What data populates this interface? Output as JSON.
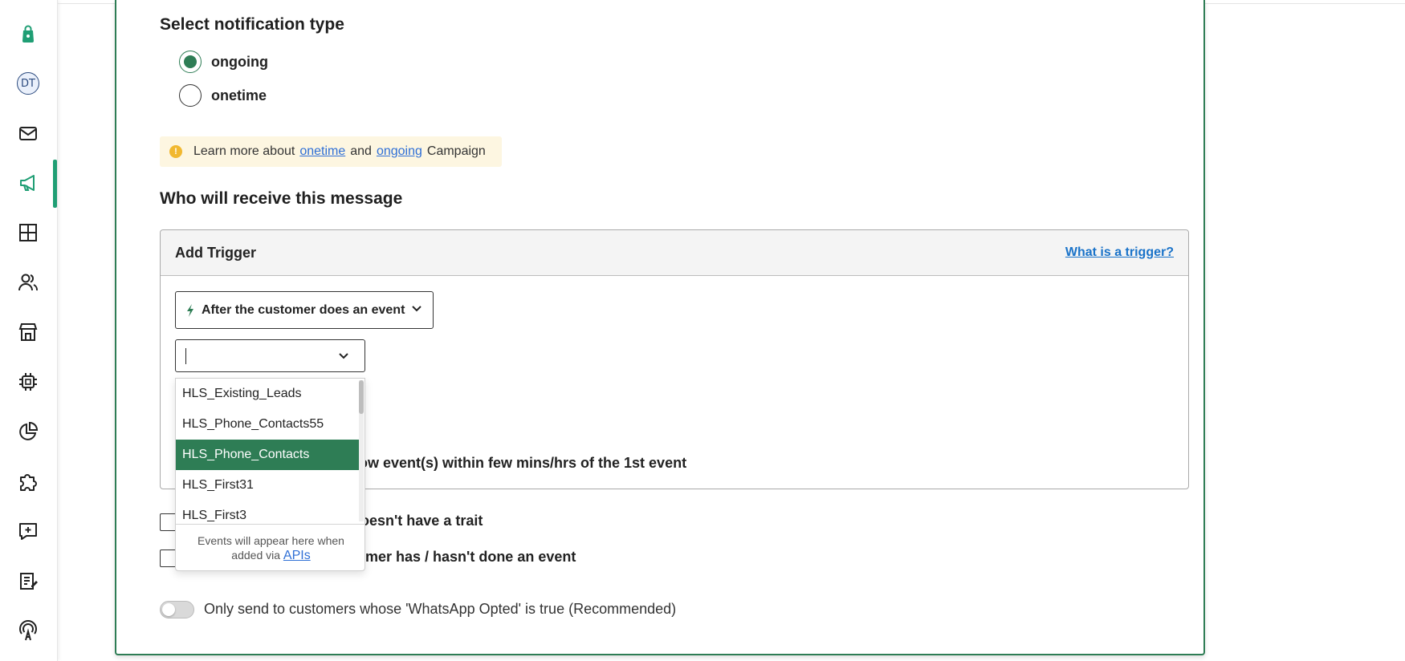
{
  "sidebar": {
    "avatar_initials": "DT",
    "items": [
      {
        "name": "shopping-bag-icon"
      },
      {
        "name": "avatar"
      },
      {
        "name": "mail-icon"
      },
      {
        "name": "megaphone-icon",
        "active": true
      },
      {
        "name": "grid-icon"
      },
      {
        "name": "users-icon"
      },
      {
        "name": "store-icon"
      },
      {
        "name": "chip-icon"
      },
      {
        "name": "pie-chart-icon"
      },
      {
        "name": "puzzle-icon"
      },
      {
        "name": "add-message-icon"
      },
      {
        "name": "clipboard-edit-icon"
      },
      {
        "name": "broadcast-icon"
      }
    ],
    "accent_color": "#1f9e74"
  },
  "notification": {
    "title": "Select notification type",
    "options": [
      {
        "label": "ongoing",
        "checked": true
      },
      {
        "label": "onetime",
        "checked": false
      }
    ]
  },
  "info": {
    "prefix": "Learn more about",
    "link1": "onetime",
    "middle": "and",
    "link2": "ongoing",
    "suffix": "Campaign"
  },
  "audience": {
    "title": "Who will receive this message"
  },
  "trigger": {
    "title": "Add Trigger",
    "help_link": "What is a trigger?",
    "event_type_label": "After the customer does an event",
    "event_input_value": "",
    "followup_text_partial": "ow event(s) within few mins/hrs of the 1st event"
  },
  "dropdown": {
    "options": [
      {
        "label": "HLS_Existing_Leads",
        "highlighted": false
      },
      {
        "label": "HLS_Phone_Contacts55",
        "highlighted": false
      },
      {
        "label": "HLS_Phone_Contacts",
        "highlighted": true
      },
      {
        "label": "HLS_First31",
        "highlighted": false
      },
      {
        "label": "HLS_First3",
        "highlighted": false
      }
    ],
    "footer_text": "Events will appear here when added via",
    "footer_link": "APIs"
  },
  "filters": [
    {
      "label_partial": "oesn't have a trait"
    },
    {
      "label_partial": "omer has / hasn't done an event"
    }
  ],
  "whatsapp_toggle": {
    "label": "Only send to customers whose 'WhatsApp Opted' is true (Recommended)",
    "on": false
  },
  "colors": {
    "primary": "#2e7d55",
    "link": "#2f6fd6",
    "info_bg": "#fdf6e1"
  }
}
